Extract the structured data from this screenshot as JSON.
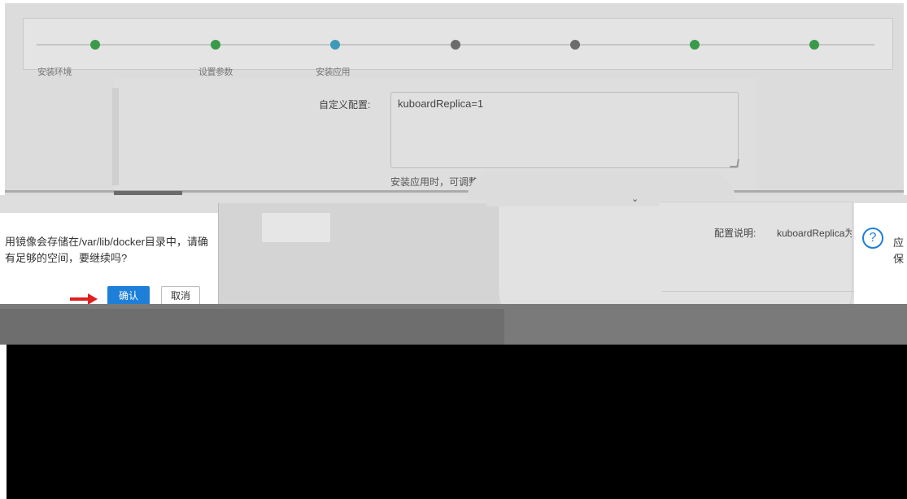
{
  "wizard": {
    "steps": [
      {
        "label": "安装环境",
        "status": "done",
        "color": "#3a9a4a"
      },
      {
        "label": "设置参数",
        "status": "done",
        "color": "#3a9a4a"
      },
      {
        "label": "安装应用",
        "status": "active",
        "color": "#3d9ab8"
      },
      {
        "label": "",
        "status": "pending",
        "color": "#6c6c6c"
      },
      {
        "label": "",
        "status": "pending",
        "color": "#6c6c6c"
      },
      {
        "label": "",
        "status": "done",
        "color": "#3a9a4a"
      },
      {
        "label": "",
        "status": "done",
        "color": "#3a9a4a"
      }
    ]
  },
  "form": {
    "custom_config_label": "自定义配置:",
    "custom_config_value": "kuboardReplica=1",
    "hint": "安装应用时，可调整的参数"
  },
  "center_panel": {
    "config_desc_label": "配置说明:",
    "config_desc_value": "kuboardReplica为"
  },
  "confirm_dialog": {
    "message": "用镜像会存储在/var/lib/docker目录中，请确有足够的空间，要继续吗?",
    "confirm_label": "确认",
    "cancel_label": "取消"
  },
  "right_dialog": {
    "help_icon": "help-circle-icon",
    "line1": "应",
    "line2": "保"
  },
  "colors": {
    "accent": "#1e7fd9",
    "arrow": "#e02020"
  }
}
